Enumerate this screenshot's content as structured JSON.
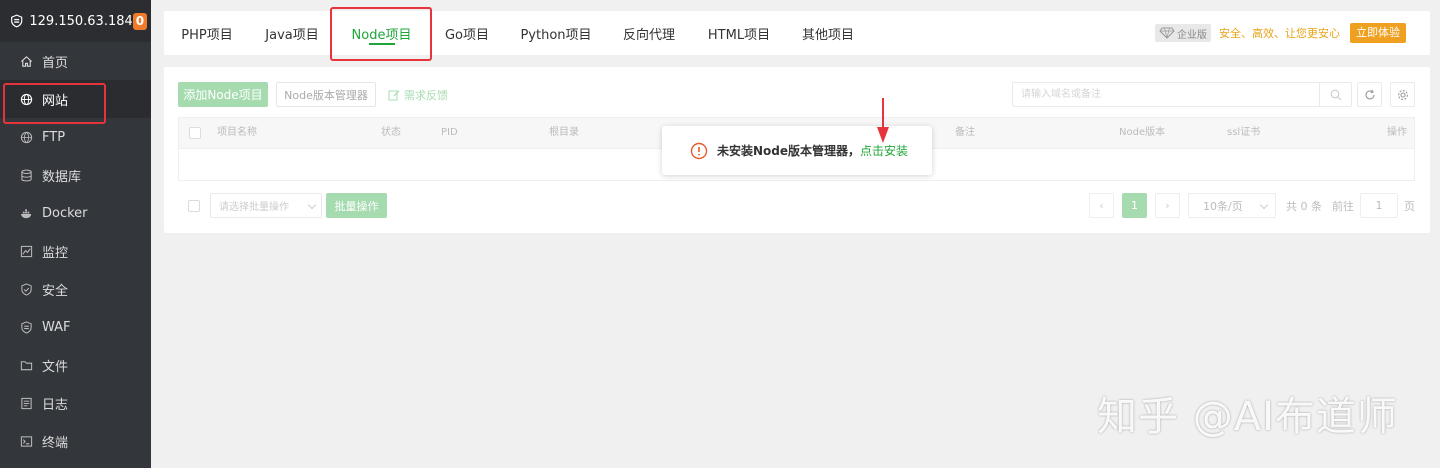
{
  "sidebar": {
    "server_ip": "129.150.63.184",
    "badge_count": "0",
    "items": [
      {
        "label": "首页",
        "icon": "home-icon"
      },
      {
        "label": "网站",
        "icon": "globe-icon"
      },
      {
        "label": "FTP",
        "icon": "ftp-icon"
      },
      {
        "label": "数据库",
        "icon": "database-icon"
      },
      {
        "label": "Docker",
        "icon": "docker-icon"
      },
      {
        "label": "监控",
        "icon": "monitor-icon"
      },
      {
        "label": "安全",
        "icon": "shield-icon"
      },
      {
        "label": "WAF",
        "icon": "waf-icon"
      },
      {
        "label": "文件",
        "icon": "folder-icon"
      },
      {
        "label": "日志",
        "icon": "log-icon"
      },
      {
        "label": "终端",
        "icon": "terminal-icon"
      }
    ]
  },
  "tabs": [
    {
      "label": "PHP项目"
    },
    {
      "label": "Java项目"
    },
    {
      "label": "Node项目"
    },
    {
      "label": "Go项目"
    },
    {
      "label": "Python项目"
    },
    {
      "label": "反向代理"
    },
    {
      "label": "HTML项目"
    },
    {
      "label": "其他项目"
    }
  ],
  "enterprise": {
    "tag": "企业版",
    "slogan": "安全、高效、让您更安心",
    "button": "立即体验"
  },
  "toolbar": {
    "add_button": "添加Node项目",
    "version_manager_button": "Node版本管理器",
    "feedback_link": "需求反馈",
    "search_placeholder": "请输入域名或备注"
  },
  "table": {
    "headers": {
      "name": "项目名称",
      "status": "状态",
      "pid": "PID",
      "root": "根目录",
      "remark": "备注",
      "node_version": "Node版本",
      "ssl": "ssl证书",
      "actions": "操作"
    }
  },
  "footer": {
    "batch_placeholder": "请选择批量操作",
    "batch_button": "批量操作",
    "current_page": "1",
    "page_size": "10条/页",
    "total": "共 0 条",
    "goto_label": "前往",
    "goto_value": "1",
    "page_unit": "页"
  },
  "toast": {
    "message": "未安装Node版本管理器，",
    "link": "点击安装"
  },
  "watermark": "知乎 @AI布道师",
  "colors": {
    "sidebar_bg": "#33363b",
    "accent_green": "#20a53a",
    "light_green": "#a6dbb0",
    "highlight_red": "#e5343c",
    "badge_orange": "#f07b2a",
    "enterprise_gold": "#f0a020"
  }
}
